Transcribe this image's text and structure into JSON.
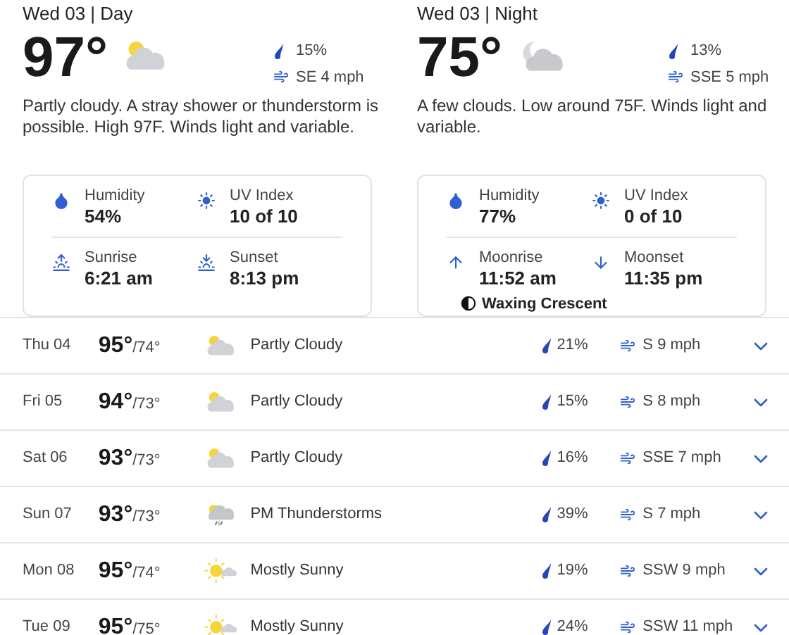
{
  "panels": [
    {
      "header": "Wed 03 | Day",
      "temp": "97°",
      "kind": "partly-cloudy",
      "precip": "15%",
      "wind": "SE 4 mph",
      "description": "Partly cloudy. A stray shower or thunderstorm is possible. High 97F. Winds light and variable.",
      "details": [
        {
          "kind": "humidity",
          "label": "Humidity",
          "value": "54%"
        },
        {
          "kind": "uv",
          "label": "UV Index",
          "value": "10 of 10"
        },
        {
          "kind": "sunrise",
          "label": "Sunrise",
          "value": "6:21 am"
        },
        {
          "kind": "sunset",
          "label": "Sunset",
          "value": "8:13 pm"
        }
      ]
    },
    {
      "header": "Wed 03 | Night",
      "temp": "75°",
      "kind": "night-cloudy",
      "precip": "13%",
      "wind": "SSE 5 mph",
      "description": "A few clouds. Low around 75F. Winds light and variable.",
      "details": [
        {
          "kind": "humidity",
          "label": "Humidity",
          "value": "77%"
        },
        {
          "kind": "uv",
          "label": "UV Index",
          "value": "0 of 10"
        },
        {
          "kind": "moonrise",
          "label": "Moonrise",
          "value": "11:52 am"
        },
        {
          "kind": "moonset",
          "label": "Moonset",
          "value": "11:35 pm"
        }
      ],
      "moon_phase": "Waxing Crescent"
    }
  ],
  "days": [
    {
      "day": "Thu 04",
      "high": "95°",
      "low": "/74°",
      "kind": "partly-cloudy",
      "condition": "Partly Cloudy",
      "precip": "21%",
      "wind": "S 9 mph"
    },
    {
      "day": "Fri 05",
      "high": "94°",
      "low": "/73°",
      "kind": "partly-cloudy",
      "condition": "Partly Cloudy",
      "precip": "15%",
      "wind": "S 8 mph"
    },
    {
      "day": "Sat 06",
      "high": "93°",
      "low": "/73°",
      "kind": "partly-cloudy",
      "condition": "Partly Cloudy",
      "precip": "16%",
      "wind": "SSE 7 mph"
    },
    {
      "day": "Sun 07",
      "high": "93°",
      "low": "/73°",
      "kind": "thunderstorm",
      "condition": "PM Thunderstorms",
      "precip": "39%",
      "wind": "S 7 mph"
    },
    {
      "day": "Mon 08",
      "high": "95°",
      "low": "/74°",
      "kind": "mostly-sunny",
      "condition": "Mostly Sunny",
      "precip": "19%",
      "wind": "SSW 9 mph"
    },
    {
      "day": "Tue 09",
      "high": "95°",
      "low": "/75°",
      "kind": "mostly-sunny",
      "condition": "Mostly Sunny",
      "precip": "24%",
      "wind": "SSW 11 mph"
    }
  ]
}
